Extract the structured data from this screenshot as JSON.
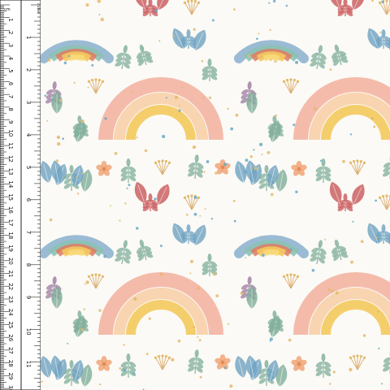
{
  "ruler": {
    "cm_labels": [
      "1",
      "2",
      "3",
      "4",
      "5",
      "6",
      "7",
      "8",
      "9",
      "10",
      "11",
      "12",
      "13",
      "14",
      "15",
      "16",
      "17",
      "18",
      "19",
      "20",
      "21",
      "22",
      "23",
      "24",
      "25",
      "26",
      "27",
      "28",
      "29",
      "30"
    ],
    "inch_labels": [
      "1",
      "2",
      "3",
      "4",
      "5",
      "6",
      "7",
      "8",
      "9",
      "10",
      "11",
      "12"
    ],
    "corner_cm": "cm",
    "corner_inch": "inches"
  },
  "colors": {
    "background": "#fbfaf6",
    "rainbow_blue": "#8fb4cf",
    "rainbow_teal": "#8cc2b4",
    "rainbow_red": "#e07a5f",
    "rainbow_yellow": "#f4c95d",
    "rainbow_pink": "#f3b4a3",
    "rainbow_peach": "#f8cfa8",
    "leaf_green": "#7fae9a",
    "leaf_blue": "#6fa3c2",
    "leaf_red": "#c9575a",
    "leaf_purple": "#9d7aa0",
    "flower_orange": "#f0a070",
    "dot_gold": "#e4b86a",
    "dot_blue": "#6aa8c8"
  }
}
